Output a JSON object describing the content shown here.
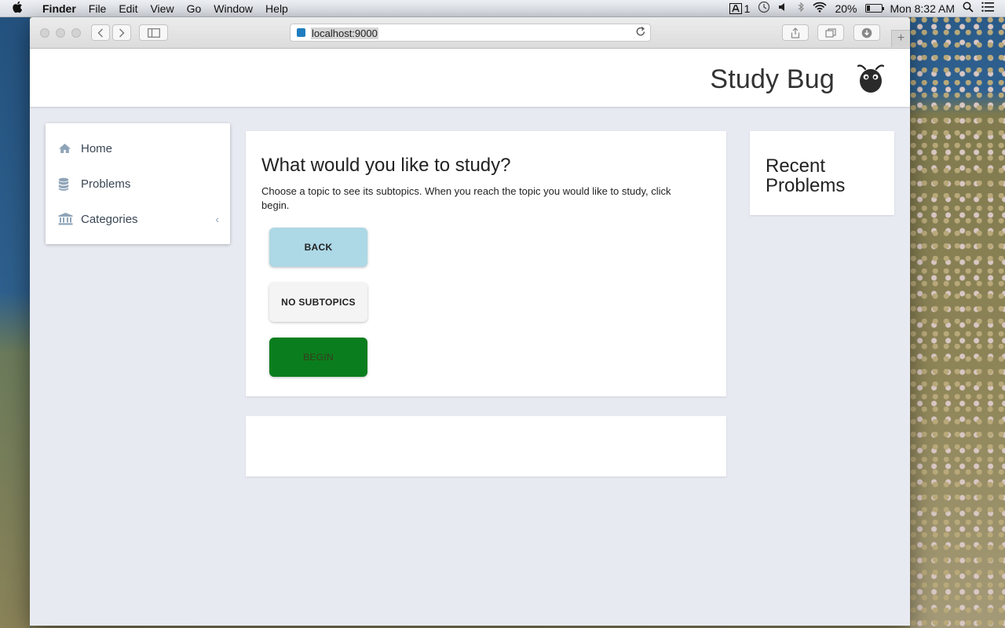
{
  "menubar": {
    "apple": "",
    "items": [
      "Finder",
      "File",
      "Edit",
      "View",
      "Go",
      "Window",
      "Help"
    ],
    "status": {
      "adobe_count": "1",
      "battery_percent": "20%",
      "battery_level": 0.2,
      "clock": "Mon 8:32 AM"
    }
  },
  "browser": {
    "url": "localhost:9000",
    "new_tab": "+"
  },
  "app": {
    "brand": "Study Bug",
    "sidebar": {
      "items": [
        {
          "label": "Home",
          "icon": "home-icon"
        },
        {
          "label": "Problems",
          "icon": "database-icon"
        },
        {
          "label": "Categories",
          "icon": "bank-icon"
        }
      ],
      "categories_chevron": "‹"
    },
    "main": {
      "heading": "What would you like to study?",
      "instructions": "Choose a topic to see its subtopics. When you reach the topic you would like to study, click begin.",
      "buttons": {
        "back": "BACK",
        "no_subtopics": "NO SUBTOPICS",
        "begin": "BEGIN"
      }
    },
    "recent": {
      "title": "Recent Problems"
    }
  },
  "colors": {
    "back_button": "#add8e6",
    "begin_button": "#0a7e1e",
    "page_background": "#e8eaf2",
    "nav_icon": "#8fa4b8"
  }
}
